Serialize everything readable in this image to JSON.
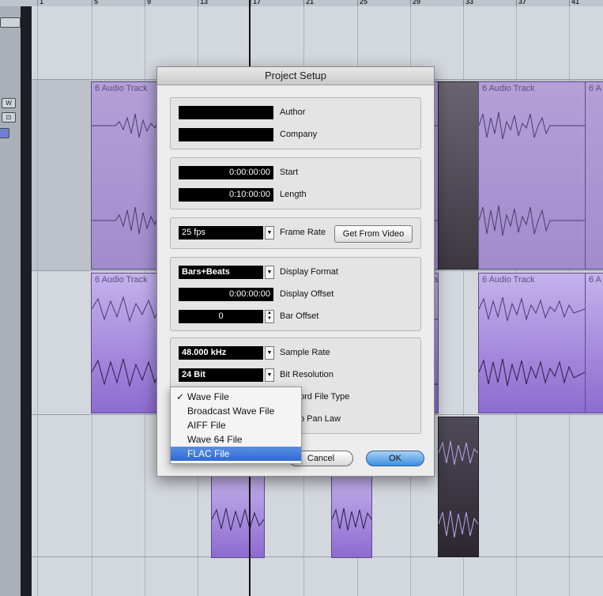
{
  "ruler": {
    "labels": [
      "1",
      "5",
      "9",
      "13",
      "17",
      "21",
      "25",
      "29",
      "33",
      "37",
      "41"
    ]
  },
  "left_panel": {
    "buttons": [
      "W",
      "⊡",
      ""
    ]
  },
  "tracks": {
    "event_name": "6 Audio Track",
    "event_name_short": "6 A",
    "event_name_trunc": "a"
  },
  "dialog": {
    "title": "Project Setup",
    "author_label": "Author",
    "author_value": "",
    "company_label": "Company",
    "company_value": "",
    "start_label": "Start",
    "start_value": "0:00:00:00",
    "length_label": "Length",
    "length_value": "0:10:00:00",
    "frame_rate_label": "Frame Rate",
    "frame_rate_value": "25 fps",
    "get_from_video_label": "Get From Video",
    "display_format_label": "Display Format",
    "display_format_value": "Bars+Beats",
    "display_offset_label": "Display Offset",
    "display_offset_value": "0:00:00:00",
    "bar_offset_label": "Bar Offset",
    "bar_offset_value": "0",
    "sample_rate_label": "Sample Rate",
    "sample_rate_value": "48.000 kHz",
    "bit_resolution_label": "Bit Resolution",
    "bit_resolution_value": "24 Bit",
    "record_file_type_label_partial": "ord File Type",
    "pan_law_label_partial": "o Pan Law",
    "cancel_label": "Cancel",
    "ok_label": "OK"
  },
  "file_type_menu": {
    "checkmark": "✓",
    "items": [
      "Wave File",
      "Broadcast Wave File",
      "AIFF File",
      "Wave 64 File",
      "FLAC File"
    ],
    "checked_index": 0,
    "highlighted_index": 4
  },
  "colors": {
    "accent": "#3d8ee0",
    "event_purple": "#a18ccd",
    "menu_highlight": "#2f6ad6"
  }
}
